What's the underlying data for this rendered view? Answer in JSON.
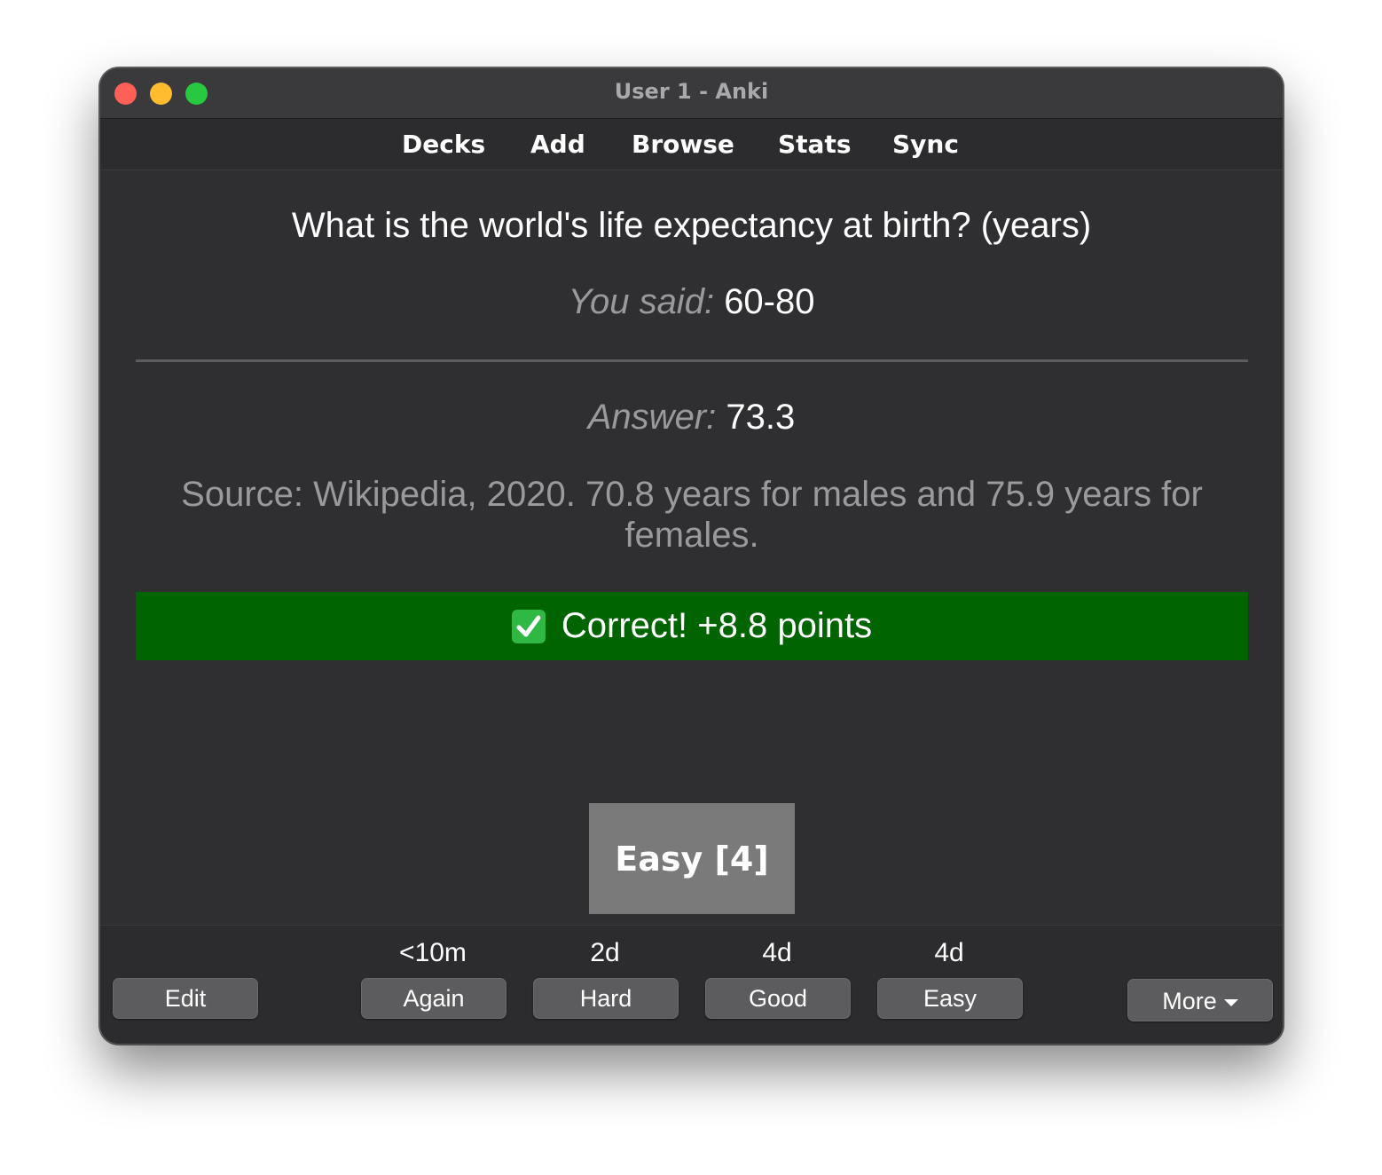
{
  "window": {
    "title": "User 1 - Anki"
  },
  "toolbar": {
    "items": [
      {
        "label": "Decks"
      },
      {
        "label": "Add"
      },
      {
        "label": "Browse"
      },
      {
        "label": "Stats"
      },
      {
        "label": "Sync"
      }
    ]
  },
  "card": {
    "question": "What is the world's life expectancy at birth? (years)",
    "you_said_label": "You said:",
    "you_said_value": "60-80",
    "answer_label": "Answer:",
    "answer_value": "73.3",
    "source": "Source: Wikipedia, 2020. 70.8 years for males and 75.9 years for females.",
    "result_text": "Correct! +8.8 points",
    "result_icon": "check-mark-box-icon",
    "result_color": "#006400",
    "easy_tile_label": "Easy [4]"
  },
  "bottom": {
    "edit_label": "Edit",
    "more_label": "More",
    "answers": [
      {
        "interval": "<10m",
        "label": "Again"
      },
      {
        "interval": "2d",
        "label": "Hard"
      },
      {
        "interval": "4d",
        "label": "Good"
      },
      {
        "interval": "4d",
        "label": "Easy"
      }
    ]
  }
}
